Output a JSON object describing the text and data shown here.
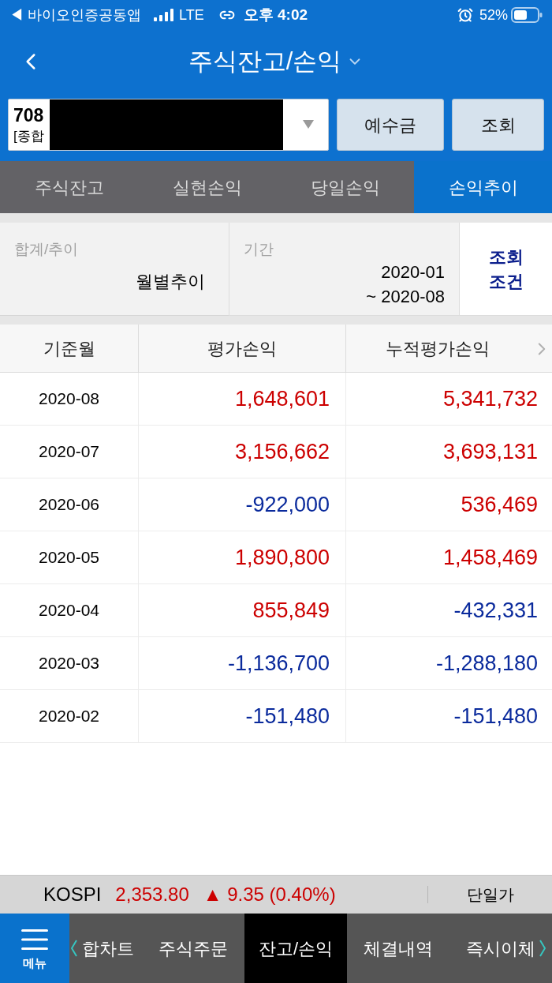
{
  "status_bar": {
    "back_app": "◀ 바이오인증공동앱",
    "network": "LTE",
    "time": "오후 4:02",
    "battery": "52%"
  },
  "header": {
    "title": "주식잔고/손익"
  },
  "account": {
    "number": "708",
    "type": "[종합",
    "buttons": [
      "예수금",
      "조회"
    ]
  },
  "tabs": [
    {
      "label": "주식잔고",
      "selected": false
    },
    {
      "label": "실현손익",
      "selected": false
    },
    {
      "label": "당일손익",
      "selected": false
    },
    {
      "label": "손익추이",
      "selected": true
    }
  ],
  "filters": [
    {
      "label": "합계/추이",
      "value": [
        "월별추이"
      ]
    },
    {
      "label": "기간",
      "value": [
        "2020-01",
        "~ 2020-08"
      ]
    }
  ],
  "filter_button": [
    "조회",
    "조건"
  ],
  "table": {
    "columns": [
      "기준월",
      "평가손익",
      "누적평가손익"
    ],
    "rows": [
      {
        "month": "2020-08",
        "cells": [
          {
            "text": "1,648,601",
            "color": "#cc0000"
          },
          {
            "text": "5,341,732",
            "color": "#cc0000"
          }
        ]
      },
      {
        "month": "2020-07",
        "cells": [
          {
            "text": "3,156,662",
            "color": "#cc0000"
          },
          {
            "text": "3,693,131",
            "color": "#cc0000"
          }
        ]
      },
      {
        "month": "2020-06",
        "cells": [
          {
            "text": "-922,000",
            "color": "#0a2a9c"
          },
          {
            "text": "536,469",
            "color": "#cc0000"
          }
        ]
      },
      {
        "month": "2020-05",
        "cells": [
          {
            "text": "1,890,800",
            "color": "#cc0000"
          },
          {
            "text": "1,458,469",
            "color": "#cc0000"
          }
        ]
      },
      {
        "month": "2020-04",
        "cells": [
          {
            "text": "855,849",
            "color": "#cc0000"
          },
          {
            "text": "-432,331",
            "color": "#0a2a9c"
          }
        ]
      },
      {
        "month": "2020-03",
        "cells": [
          {
            "text": "-1,136,700",
            "color": "#0a2a9c"
          },
          {
            "text": "-1,288,180",
            "color": "#0a2a9c"
          }
        ]
      },
      {
        "month": "2020-02",
        "cells": [
          {
            "text": "-151,480",
            "color": "#0a2a9c"
          },
          {
            "text": "-151,480",
            "color": "#0a2a9c"
          }
        ]
      }
    ]
  },
  "ticker": {
    "label": "KOSPI",
    "value": "2,353.80",
    "change": "▲ 9.35 (0.40%)",
    "color": "#cc0000",
    "mode": "단일가"
  },
  "bottom_nav": {
    "menu": "메뉴",
    "items": [
      {
        "label": "합차트",
        "selected": false
      },
      {
        "label": "주식주문",
        "selected": false
      },
      {
        "label": "잔고/손익",
        "selected": true
      },
      {
        "label": "체결내역",
        "selected": false
      },
      {
        "label": "즉시이체",
        "selected": false
      }
    ]
  }
}
